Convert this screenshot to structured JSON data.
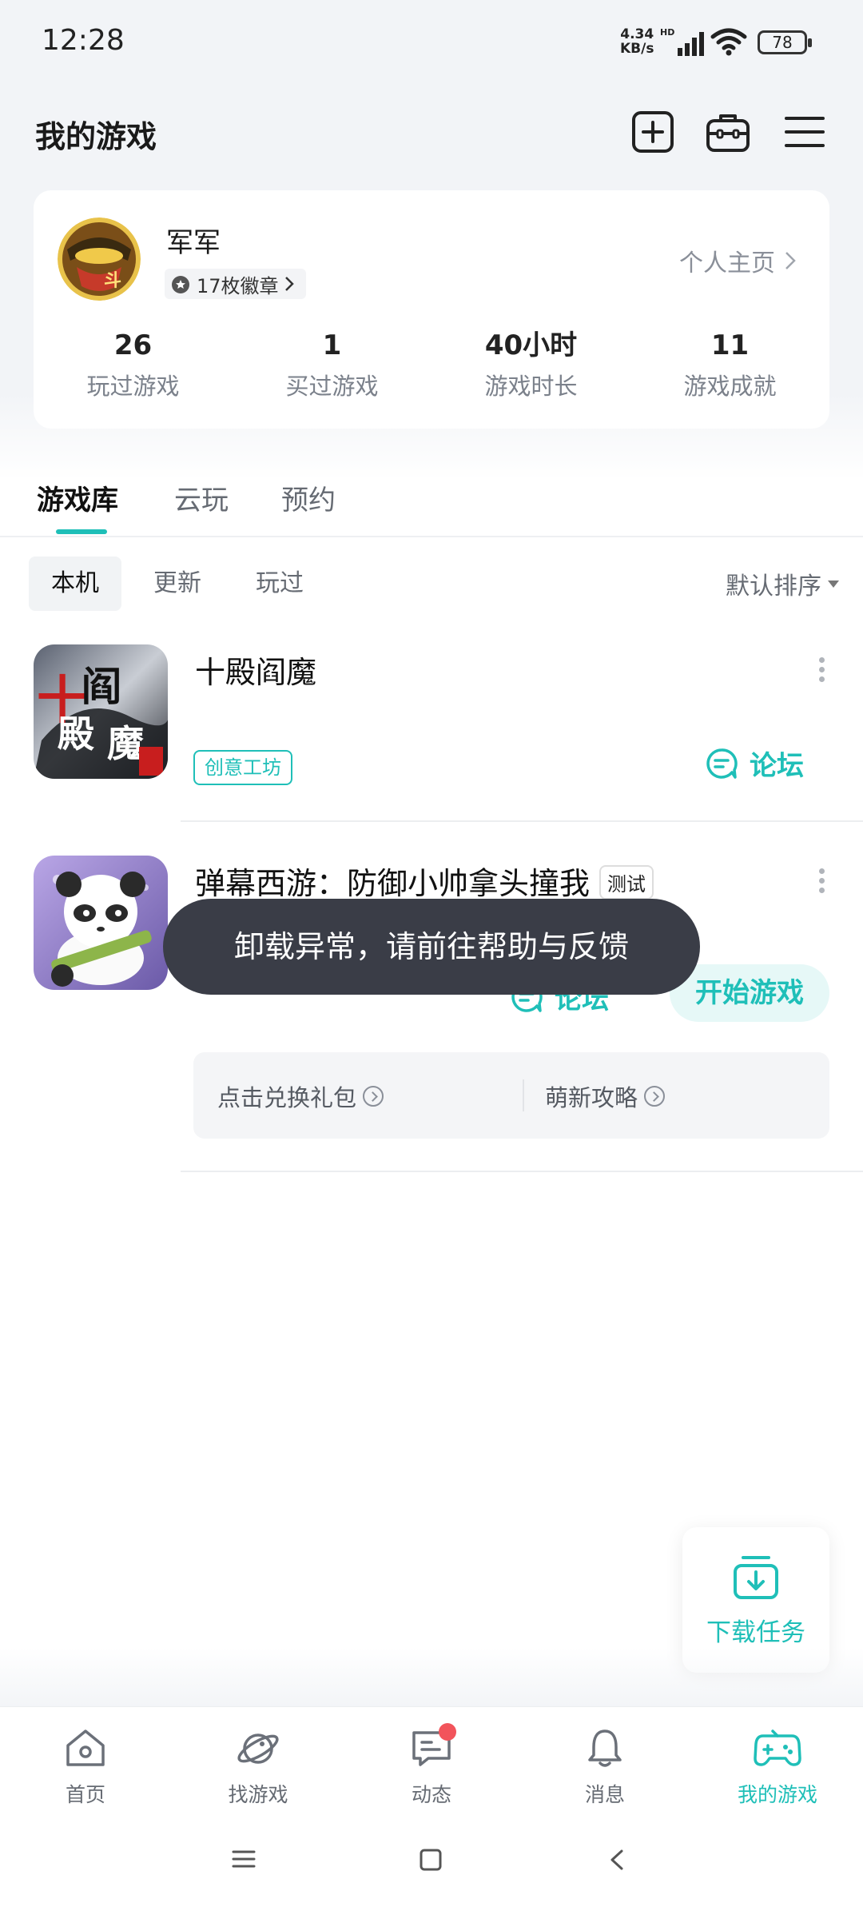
{
  "status_bar": {
    "time": "12:28",
    "net_speed_value": "4.34",
    "net_speed_unit": "KB/s",
    "net_type": "HD",
    "battery": "78"
  },
  "header": {
    "title": "我的游戏",
    "icons": [
      "add-square-icon",
      "briefcase-icon",
      "menu-icon"
    ]
  },
  "profile": {
    "username": "军军",
    "badges": "17枚徽章",
    "homepage_link": "个人主页",
    "stats": [
      {
        "value": "26",
        "label": "玩过游戏"
      },
      {
        "value": "1",
        "label": "买过游戏"
      },
      {
        "value": "40小时",
        "label": "游戏时长"
      },
      {
        "value": "11",
        "label": "游戏成就"
      }
    ]
  },
  "main_tabs": [
    "游戏库",
    "云玩",
    "预约"
  ],
  "sub_tabs": [
    "本机",
    "更新",
    "玩过"
  ],
  "sort_label": "默认排序",
  "games": [
    {
      "title": "十殿阎魔",
      "tag": "创意工坊",
      "forum": "论坛"
    },
    {
      "title": "弹幕西游：防御小帅拿头撞我",
      "badge": "测试",
      "forum": "论坛",
      "play": "开始游戏",
      "gift": "点击兑换礼包",
      "guide": "萌新攻略"
    }
  ],
  "toast": "卸载异常，请前往帮助与反馈",
  "download_fab": "下载任务",
  "bottom_nav": [
    {
      "label": "首页",
      "icon": "home-icon"
    },
    {
      "label": "找游戏",
      "icon": "planet-icon"
    },
    {
      "label": "动态",
      "icon": "chat-icon"
    },
    {
      "label": "消息",
      "icon": "bell-icon"
    },
    {
      "label": "我的游戏",
      "icon": "gamepad-icon"
    }
  ],
  "colors": {
    "accent": "#1fbfb8",
    "background": "#f2f4f7",
    "toast": "#3a3d47",
    "notification": "#f2545b"
  }
}
